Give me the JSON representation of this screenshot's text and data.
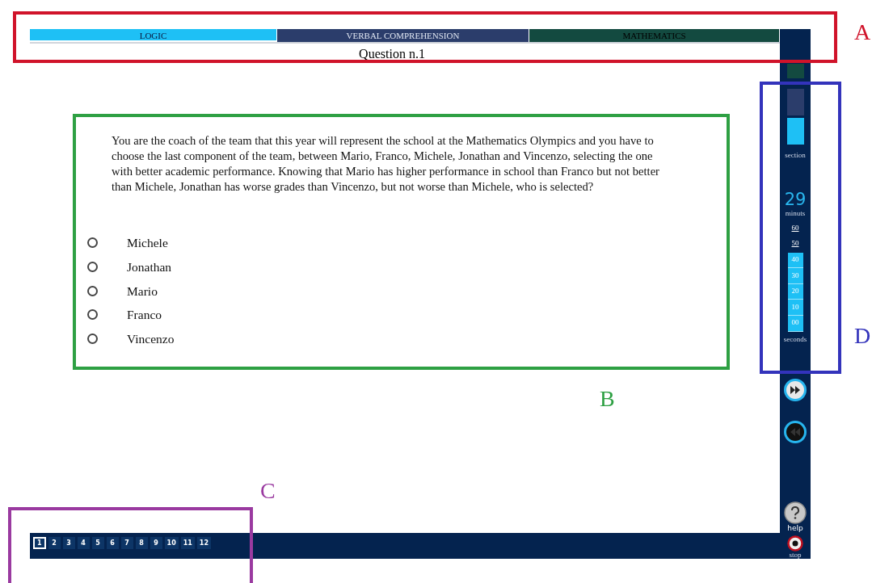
{
  "tabs": [
    {
      "label": "LOGIC",
      "selected": true,
      "color": "#1ec0f5"
    },
    {
      "label": "VERBAL COMPREHENSION",
      "selected": false,
      "color": "#2b3d6b"
    },
    {
      "label": "MATHEMATICS",
      "selected": false,
      "color": "#134a40"
    }
  ],
  "question_title": "Question n.1",
  "question": {
    "text": "You are the coach of the team that this year will represent the school at the Mathematics Olympics and you have to choose the last component of the team, between Mario, Franco, Michele, Jonathan and Vincenzo, selecting the one with better academic performance. Knowing that Mario has higher performance in school than Franco but not better than Michele, Jonathan has worse grades than Vincenzo, but not worse than Michele, who is selected?",
    "options": [
      {
        "label": "Michele",
        "selected": false
      },
      {
        "label": "Jonathan",
        "selected": false
      },
      {
        "label": "Mario",
        "selected": false
      },
      {
        "label": "Franco",
        "selected": false
      },
      {
        "label": "Vincenzo",
        "selected": false
      }
    ]
  },
  "sidebar": {
    "section_blocks": [
      {
        "color": "#134a40"
      },
      {
        "color": "#2b3d6b"
      },
      {
        "color": "#1ec0f5"
      }
    ],
    "section_label": "section",
    "minutes": "29",
    "minutes_label": "minuts",
    "seconds_ticks": [
      {
        "label": "60",
        "on": false
      },
      {
        "label": "50",
        "on": false
      },
      {
        "label": "40",
        "on": true
      },
      {
        "label": "30",
        "on": true
      },
      {
        "label": "20",
        "on": true
      },
      {
        "label": "10",
        "on": true
      },
      {
        "label": "00",
        "on": true
      }
    ],
    "seconds_label": "seconds",
    "help_label": "help",
    "stop_label": "stop"
  },
  "question_numbers": [
    {
      "label": "1",
      "selected": true
    },
    {
      "label": "2",
      "selected": false
    },
    {
      "label": "3",
      "selected": false
    },
    {
      "label": "4",
      "selected": false
    },
    {
      "label": "5",
      "selected": false
    },
    {
      "label": "6",
      "selected": false
    },
    {
      "label": "7",
      "selected": false
    },
    {
      "label": "8",
      "selected": false
    },
    {
      "label": "9",
      "selected": false
    },
    {
      "label": "10",
      "selected": false
    },
    {
      "label": "11",
      "selected": false
    },
    {
      "label": "12",
      "selected": false
    }
  ],
  "annotations": [
    {
      "label": "A",
      "color": "#d0132a"
    },
    {
      "label": "B",
      "color": "#2ea043"
    },
    {
      "label": "C",
      "color": "#9a3aa0"
    },
    {
      "label": "D",
      "color": "#3333bb"
    }
  ]
}
